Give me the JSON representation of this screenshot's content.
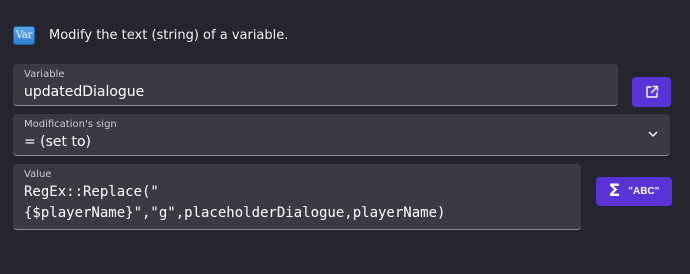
{
  "header": {
    "icon_text": "Var",
    "icon": "variable-icon",
    "description": "Modify the text (string) of a variable."
  },
  "variable_field": {
    "label": "Variable",
    "value": "updatedDialogue"
  },
  "open_button": {
    "icon": "external-link-icon"
  },
  "modification_field": {
    "label": "Modification's sign",
    "value": "= (set to)",
    "icon": "chevron-down-icon"
  },
  "value_field": {
    "label": "Value",
    "lines": [
      "RegEx::Replace(\"",
      "{$playerName}\",\"g\",placeholderDialogue,playerName)"
    ]
  },
  "expression_button": {
    "sigma": "Σ",
    "label": "\"ABC\""
  },
  "colors": {
    "background": "#25252e",
    "field_background": "#3a3a44",
    "accent": "#5a33d6",
    "icon_blue": "#3d8ddd"
  }
}
